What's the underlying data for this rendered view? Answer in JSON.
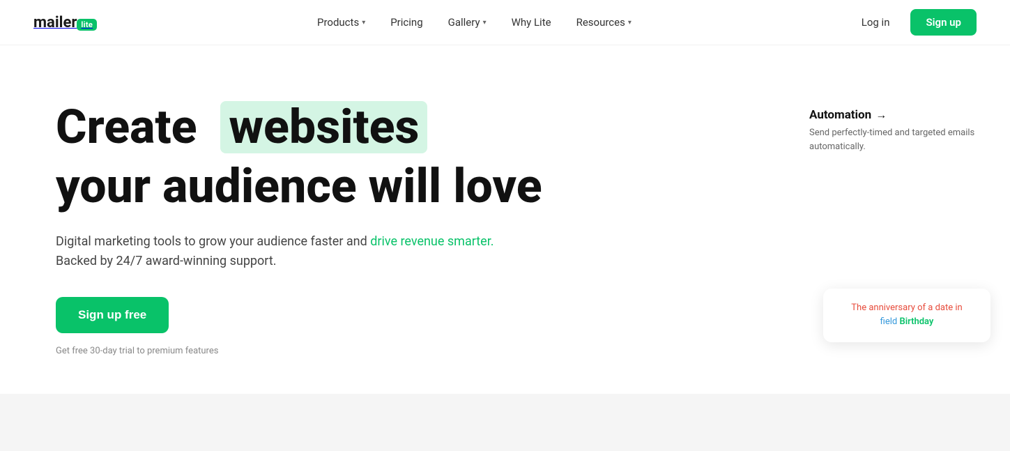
{
  "nav": {
    "logo": {
      "mailer": "mailer",
      "lite": "lite"
    },
    "links": [
      {
        "label": "Products",
        "hasDropdown": true
      },
      {
        "label": "Pricing",
        "hasDropdown": false
      },
      {
        "label": "Gallery",
        "hasDropdown": true
      },
      {
        "label": "Why Lite",
        "hasDropdown": false
      },
      {
        "label": "Resources",
        "hasDropdown": true
      }
    ],
    "login_label": "Log in",
    "signup_label": "Sign up"
  },
  "hero": {
    "headline_prefix": "Create",
    "headline_highlight": "websites",
    "headline_suffix": "your audience will love",
    "description": "Digital marketing tools to grow your audience faster and drive revenue smarter. Backed by 24/7 award-winning support.",
    "cta_label": "Sign up free",
    "trial_text": "Get free 30-day trial to premium features"
  },
  "automation": {
    "title": "Automation",
    "arrow": "→",
    "description": "Send perfectly-timed and targeted emails automatically."
  },
  "birthday_card": {
    "line1": "The anniversary of a date in",
    "line2": "field",
    "field_name": "Birthday"
  }
}
